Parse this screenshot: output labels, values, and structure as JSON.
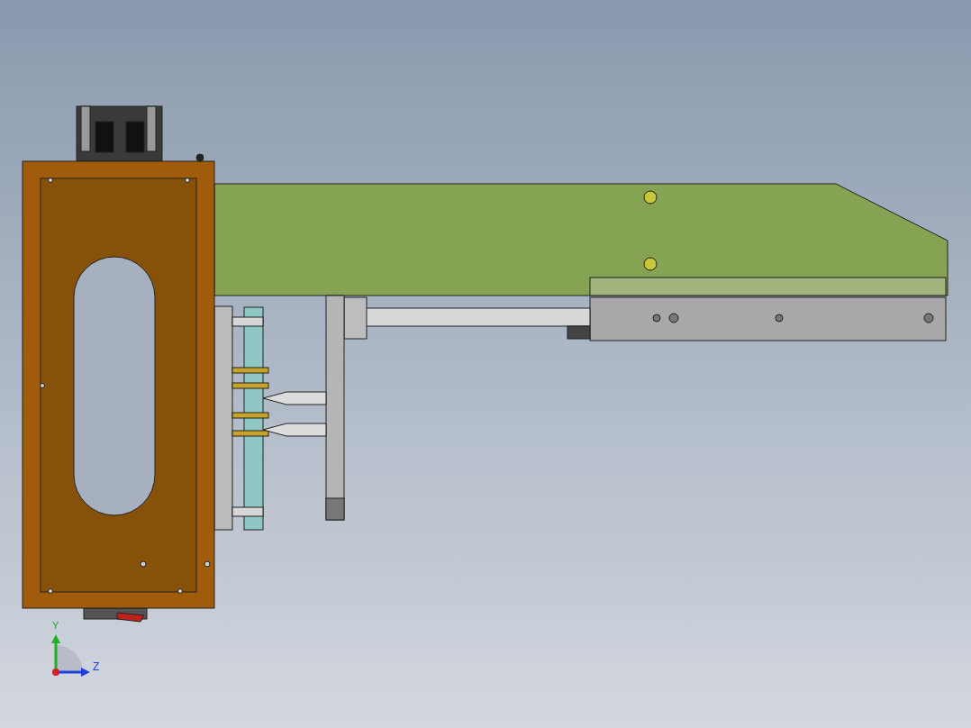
{
  "viewport": {
    "triad": {
      "axes": [
        {
          "label": "Y",
          "color": "#1fb11f"
        },
        {
          "label": "Z",
          "color": "#1f3fd8"
        }
      ]
    }
  }
}
